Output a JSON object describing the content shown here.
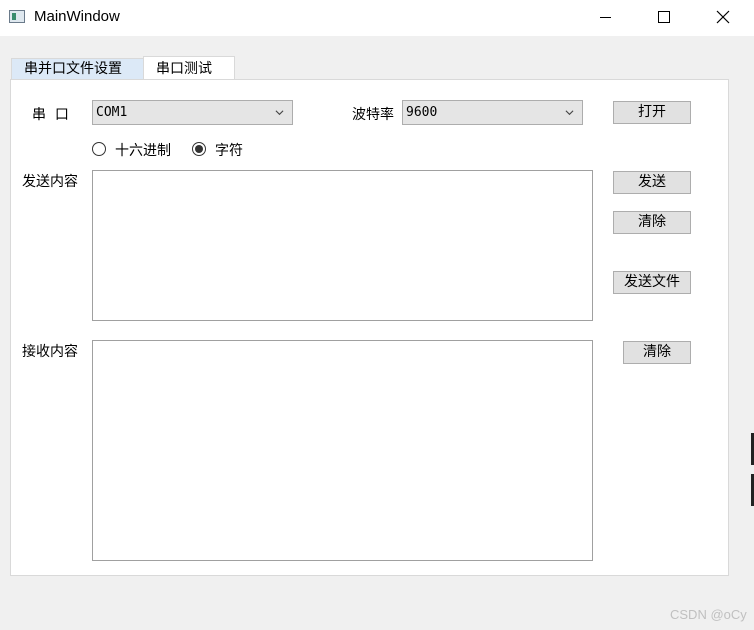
{
  "window": {
    "title": "MainWindow"
  },
  "tabs": [
    {
      "label": "串并口文件设置"
    },
    {
      "label": "串口测试"
    }
  ],
  "port": {
    "label": "串  口",
    "value": "COM1"
  },
  "baud": {
    "label": "波特率",
    "value": "9600"
  },
  "open_button": "打开",
  "format": {
    "hex_label": "十六进制",
    "char_label": "字符",
    "selected": "字符"
  },
  "send": {
    "label": "发送内容",
    "content": "",
    "send_button": "发送",
    "clear_button": "清除",
    "send_file_button": "发送文件"
  },
  "receive": {
    "label": "接收内容",
    "content": "",
    "clear_button": "清除"
  },
  "watermark": "CSDN @oCy"
}
